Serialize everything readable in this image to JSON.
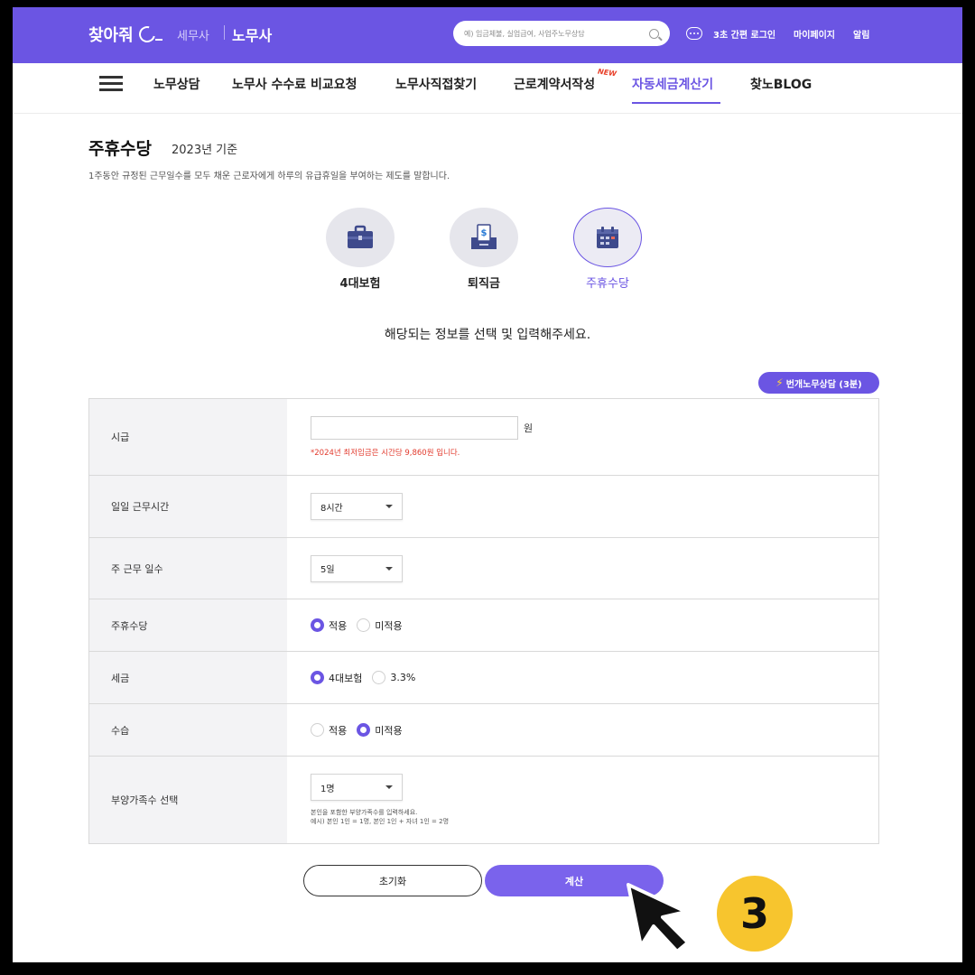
{
  "header": {
    "logo": "찾아줘",
    "site_tax": "세무사",
    "site_labor": "노무사",
    "search_placeholder": "예) 임금체불, 실업급여, 사업주노무상담",
    "links": [
      "3초 간편 로그인",
      "마이페이지",
      "알림"
    ]
  },
  "nav": {
    "items": [
      "노무상담",
      "노무사 수수료 비교요청",
      "노무사직접찾기",
      "근로계약서작성",
      "자동세금계산기",
      "찾노BLOG"
    ],
    "new_badge": "NEW",
    "active_index": 4
  },
  "page": {
    "title": "주휴수당",
    "title_sub": "2023년 기준",
    "description": "1주동안 규정된 근무일수를 모두 채운 근로자에게 하루의 유급휴일을 부여하는 제도를 말합니다.",
    "instruction": "해당되는 정보를 선택 및 입력해주세요."
  },
  "categories": [
    {
      "label": "4대보험",
      "icon": "briefcase-icon"
    },
    {
      "label": "퇴직금",
      "icon": "money-tray-icon"
    },
    {
      "label": "주휴수당",
      "icon": "calendar-icon"
    }
  ],
  "quick_consult": "번개노무상담 (3분)",
  "form": {
    "wage": {
      "label": "시급",
      "value": "",
      "unit": "원",
      "note": "*2024년 최저임금은 시간당 9,860원 입니다."
    },
    "daily_hours": {
      "label": "일일 근무시간",
      "value": "8시간"
    },
    "weekly_days": {
      "label": "주 근무 일수",
      "value": "5일"
    },
    "holiday_pay": {
      "label": "주휴수당",
      "options": [
        "적용",
        "미적용"
      ],
      "selected": "적용"
    },
    "tax": {
      "label": "세금",
      "options": [
        "4대보험",
        "3.3%"
      ],
      "selected": "4대보험"
    },
    "probation": {
      "label": "수습",
      "options": [
        "적용",
        "미적용"
      ],
      "selected": "미적용"
    },
    "dependents": {
      "label": "부양가족수 선택",
      "value": "1명",
      "note_line1": "본인을 포함한 부양가족수를 입력하세요.",
      "note_line2": "예시) 본인 1인 = 1명, 본인 1인 + 자녀 1인 = 2명"
    }
  },
  "buttons": {
    "reset": "초기화",
    "calculate": "계산"
  },
  "step_badge": "3",
  "colors": {
    "brand": "#6b55e3",
    "badge": "#f7c52e",
    "warning": "#e23b2e"
  }
}
